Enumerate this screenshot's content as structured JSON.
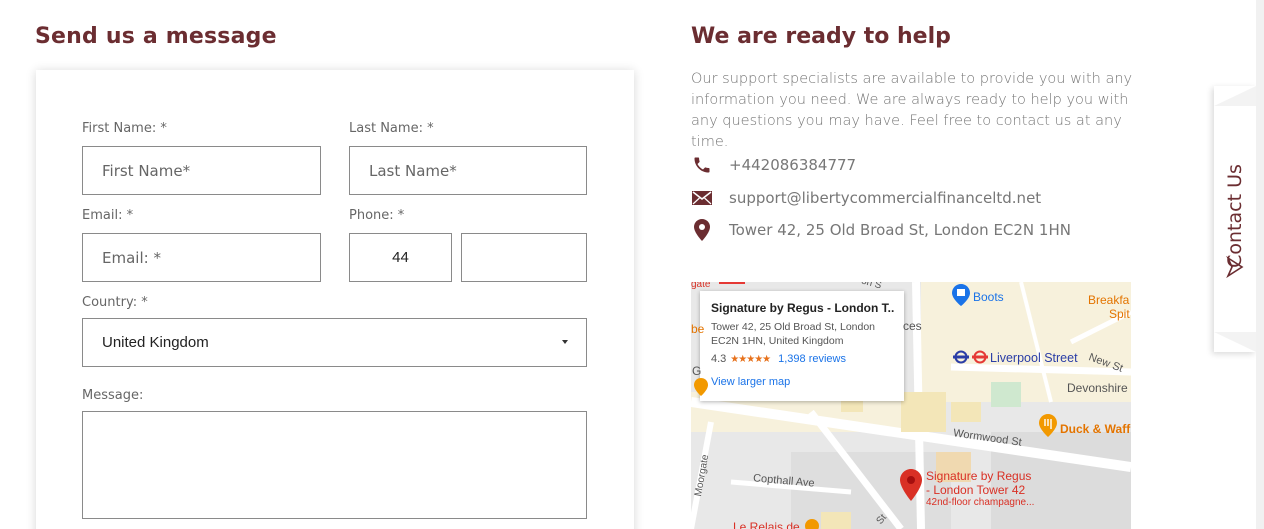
{
  "form": {
    "title": "Send us a message",
    "first_name": {
      "label": "First Name: *",
      "placeholder": "First Name*"
    },
    "last_name": {
      "label": "Last Name: *",
      "placeholder": "Last Name*"
    },
    "email": {
      "label": "Email: *",
      "placeholder": "Email: *"
    },
    "phone": {
      "label": "Phone: *",
      "country_code": "44",
      "number": ""
    },
    "country": {
      "label": "Country: *",
      "selected": "United Kingdom"
    },
    "message": {
      "label": "Message:",
      "value": ""
    }
  },
  "help": {
    "title": "We are ready to help",
    "intro": "Our support specialists are available to provide you with any information you need. We are always ready to help you with any questions you may have. Feel free to contact us at any time.",
    "phone": "+442086384777",
    "email": "support@libertycommercialfinanceltd.net",
    "address": "Tower 42, 25 Old Broad St, London EC2N 1HN",
    "icons": [
      "phone-icon",
      "envelope-icon",
      "location-pin-icon"
    ]
  },
  "map": {
    "card": {
      "title": "Signature by Regus - London T...",
      "address": "Tower 42, 25 Old Broad St, London EC2N 1HN, United Kingdom",
      "rating": "4.3",
      "stars": "★★★★★",
      "reviews": "1,398 reviews",
      "link": "View larger map"
    },
    "labels": {
      "boots": "Boots",
      "breakfast": "Breakfa",
      "spit": "Spit",
      "liverpool": "Liverpool Street",
      "new_st": "New St",
      "devonshire": "Devonshire",
      "duck": "Duck & Waff",
      "wormwood": "Wormwood St",
      "copthall": "Copthall Ave",
      "regus_pin_1": "Signature by Regus",
      "regus_pin_2": "- London Tower 42",
      "regus_pin_3": "42nd-floor champagne...",
      "relais": "Le Relais de",
      "ces": "ces",
      "gate": "gate",
      "moorgate": "Moorgate",
      "g": "G",
      "be": "be",
      "st": "St",
      "on_s": "on S"
    },
    "colors": {
      "pin": "#d93025",
      "transit": "#2a3da6",
      "poi": "#f29900",
      "rail": "#e53935"
    }
  },
  "side_tab": {
    "label": "Contact Us"
  },
  "colors": {
    "brand": "#6b2d31",
    "text_muted": "#777777"
  }
}
